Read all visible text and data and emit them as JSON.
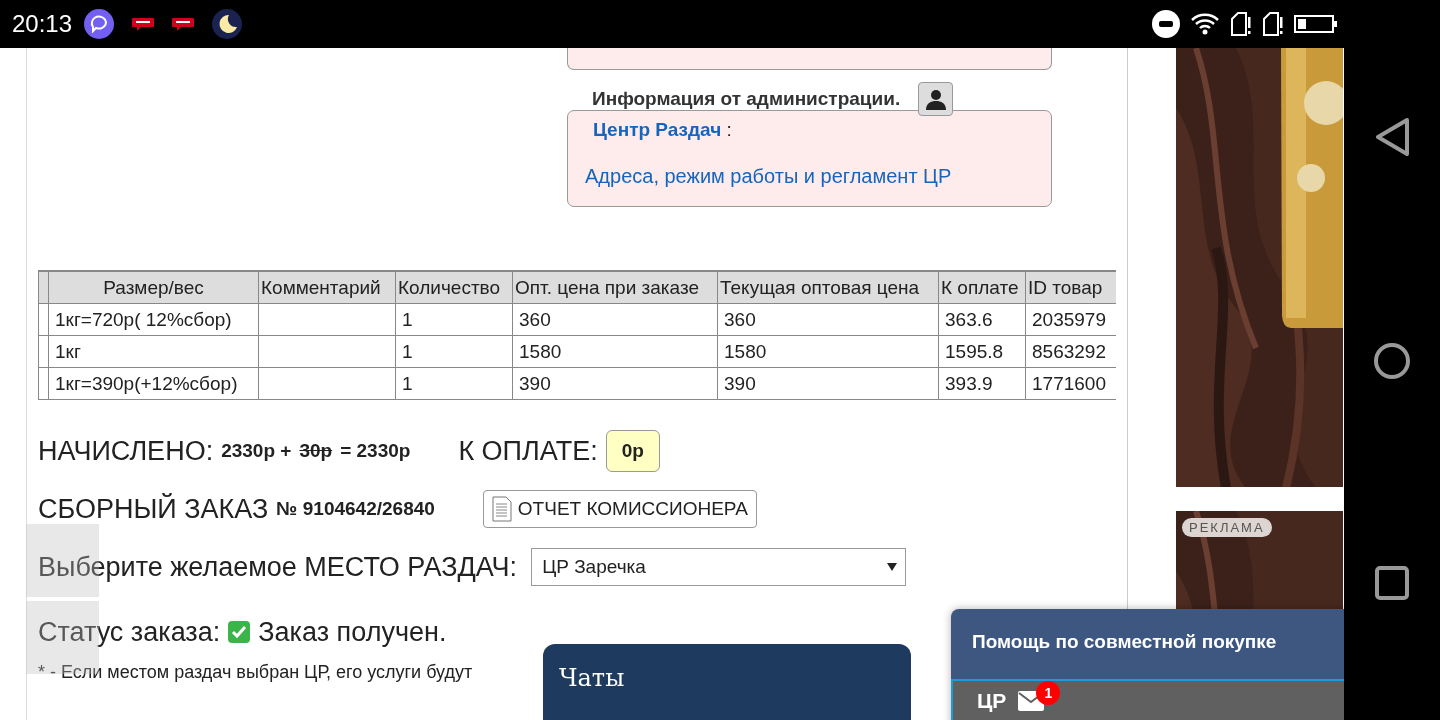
{
  "status_bar": {
    "time": "20:13"
  },
  "admin_info": {
    "title": "Информация от администрации.",
    "center_link": "Центр Раздач",
    "separator": " :",
    "rules_link": "Адреса, режим работы и регламент ЦР"
  },
  "order_table": {
    "columns": [
      "Размер/вес",
      "Комментарий",
      "Количество",
      "Опт. цена при заказе",
      "Текущая оптовая цена",
      "К оплате",
      "ID товар"
    ],
    "rows": [
      {
        "cells": [
          "1кг=720р( 12%сбор)",
          "",
          "1",
          "360",
          "360",
          "363.6",
          "2035979"
        ]
      },
      {
        "cells": [
          "1кг",
          "",
          "1",
          "1580",
          "1580",
          "1595.8",
          "8563292"
        ]
      },
      {
        "cells": [
          "1кг=390р(+12%сбор)",
          "",
          "1",
          "390",
          "390",
          "393.9",
          "1771600"
        ]
      }
    ]
  },
  "charged": {
    "label": "НАЧИСЛЕНО:",
    "amount": "2330р +",
    "struck": "30р",
    "total": "= 2330р"
  },
  "to_pay": {
    "label": "К ОПЛАТЕ:",
    "value": "0р"
  },
  "group_order": {
    "label": "СБОРНЫЙ ЗАКАЗ",
    "number": "№ 9104642/26840",
    "report_button": "ОТЧЕТ КОМИССИОНЕРА"
  },
  "pickup": {
    "label": "Выберите желаемое МЕСТО РАЗДАЧ:",
    "value": "ЦР Заречка"
  },
  "order_status": {
    "label": "Статус заказа:",
    "value": "Заказ получен.",
    "done": true
  },
  "footnote": "* - Если местом раздач выбран ЦР, его услуги будут",
  "ads": [
    {
      "kind": "picture"
    },
    {
      "kind": "picture",
      "badge": "РЕКЛАМА"
    }
  ],
  "chats_panel": {
    "title": "Чаты"
  },
  "help_panel": {
    "title": "Помощь по совместной покупке",
    "tab": "ЦР",
    "unread": "1"
  }
}
